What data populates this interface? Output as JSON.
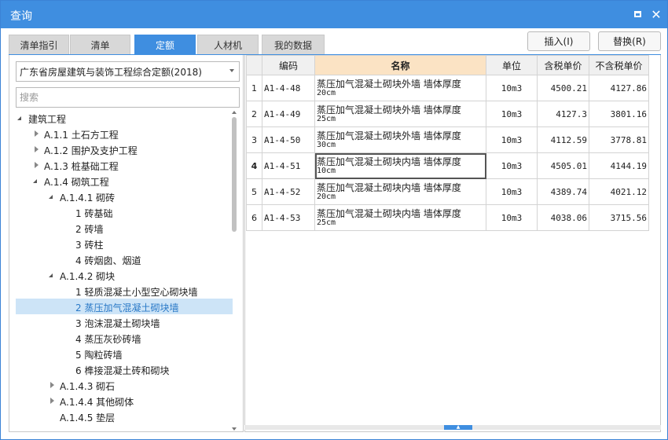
{
  "window": {
    "title": "查询"
  },
  "tabs": [
    {
      "label": "清单指引",
      "active": false
    },
    {
      "label": "清单",
      "active": false
    },
    {
      "label": "定额",
      "active": true
    },
    {
      "label": "人材机",
      "active": false
    },
    {
      "label": "我的数据",
      "active": false
    }
  ],
  "actions": {
    "insert": "插入(I)",
    "replace": "替换(R)"
  },
  "library": {
    "selected": "广东省房屋建筑与装饰工程综合定额(2018)"
  },
  "search": {
    "placeholder": "搜索"
  },
  "tree": [
    {
      "label": "建筑工程",
      "level": 0,
      "expander": "open"
    },
    {
      "label": "A.1.1 土石方工程",
      "level": 1,
      "expander": "closed"
    },
    {
      "label": "A.1.2 围护及支护工程",
      "level": 1,
      "expander": "closed"
    },
    {
      "label": "A.1.3 桩基础工程",
      "level": 1,
      "expander": "closed"
    },
    {
      "label": "A.1.4 砌筑工程",
      "level": 1,
      "expander": "open"
    },
    {
      "label": "A.1.4.1 砌砖",
      "level": 2,
      "expander": "open"
    },
    {
      "label": "1 砖基础",
      "level": 3,
      "expander": "none"
    },
    {
      "label": "2 砖墙",
      "level": 3,
      "expander": "none"
    },
    {
      "label": "3 砖柱",
      "level": 3,
      "expander": "none"
    },
    {
      "label": "4 砖烟囱、烟道",
      "level": 3,
      "expander": "none"
    },
    {
      "label": "A.1.4.2 砌块",
      "level": 2,
      "expander": "open"
    },
    {
      "label": "1 轻质混凝土小型空心砌块墙",
      "level": 3,
      "expander": "none"
    },
    {
      "label": "2 蒸压加气混凝土砌块墙",
      "level": 3,
      "expander": "none",
      "selected": true
    },
    {
      "label": "3 泡沫混凝土砌块墙",
      "level": 3,
      "expander": "none"
    },
    {
      "label": "4 蒸压灰砂砖墙",
      "level": 3,
      "expander": "none"
    },
    {
      "label": "5 陶粒砖墙",
      "level": 3,
      "expander": "none"
    },
    {
      "label": "6 榫接混凝土砖和砌块",
      "level": 3,
      "expander": "none"
    },
    {
      "label": "A.1.4.3 砌石",
      "level": 2,
      "expander": "closed"
    },
    {
      "label": "A.1.4.4 其他砌体",
      "level": 2,
      "expander": "closed"
    },
    {
      "label": "A.1.4.5 垫层",
      "level": 2,
      "expander": "none"
    }
  ],
  "grid": {
    "headers": [
      "",
      "编码",
      "名称",
      "单位",
      "含税单价",
      "不含税单价"
    ],
    "rows": [
      {
        "no": "1",
        "code": "A1-4-48",
        "name": "蒸压加气混凝土砌块外墙 墙体厚度",
        "thick": "20cm",
        "unit": "10m3",
        "price_tax": "4500.21",
        "price_notax": "4127.86"
      },
      {
        "no": "2",
        "code": "A1-4-49",
        "name": "蒸压加气混凝土砌块外墙 墙体厚度",
        "thick": "25cm",
        "unit": "10m3",
        "price_tax": "4127.3",
        "price_notax": "3801.16"
      },
      {
        "no": "3",
        "code": "A1-4-50",
        "name": "蒸压加气混凝土砌块外墙 墙体厚度",
        "thick": "30cm",
        "unit": "10m3",
        "price_tax": "4112.59",
        "price_notax": "3778.81"
      },
      {
        "no": "4",
        "code": "A1-4-51",
        "name": "蒸压加气混凝土砌块内墙 墙体厚度",
        "thick": "10cm",
        "unit": "10m3",
        "price_tax": "4505.01",
        "price_notax": "4144.19",
        "current": true
      },
      {
        "no": "5",
        "code": "A1-4-52",
        "name": "蒸压加气混凝土砌块内墙 墙体厚度",
        "thick": "20cm",
        "unit": "10m3",
        "price_tax": "4389.74",
        "price_notax": "4021.12"
      },
      {
        "no": "6",
        "code": "A1-4-53",
        "name": "蒸压加气混凝土砌块内墙 墙体厚度",
        "thick": "25cm",
        "unit": "10m3",
        "price_tax": "4038.06",
        "price_notax": "3715.56"
      }
    ]
  },
  "colors": {
    "accent": "#3f8ee0",
    "header_highlight": "#fbe3c4",
    "selection": "#cde4f7"
  }
}
